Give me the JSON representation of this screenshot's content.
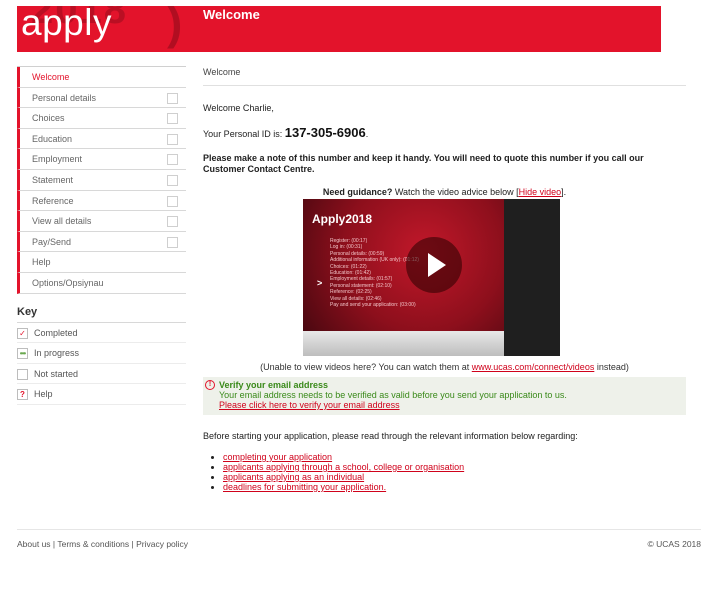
{
  "header": {
    "logo_text": "apply",
    "logo_year": "2018",
    "title": "Welcome",
    "accent_color": "#e3132b"
  },
  "sidebar": {
    "items": [
      {
        "label": "Welcome",
        "active": true,
        "has_checkbox": false
      },
      {
        "label": "Personal details",
        "has_checkbox": true
      },
      {
        "label": "Choices",
        "has_checkbox": true
      },
      {
        "label": "Education",
        "has_checkbox": true
      },
      {
        "label": "Employment",
        "has_checkbox": true
      },
      {
        "label": "Statement",
        "has_checkbox": true
      },
      {
        "label": "Reference",
        "has_checkbox": true
      },
      {
        "label": "View all details",
        "has_checkbox": true
      },
      {
        "label": "Pay/Send",
        "has_checkbox": true
      },
      {
        "label": "Help",
        "has_checkbox": false
      },
      {
        "label": "Options/Opsiynau",
        "has_checkbox": false
      }
    ]
  },
  "key": {
    "title": "Key",
    "items": [
      {
        "label": "Completed",
        "icon": "check-icon",
        "glyph": "✓"
      },
      {
        "label": "In progress",
        "icon": "dots-icon",
        "glyph": "•••"
      },
      {
        "label": "Not started",
        "icon": "empty-box-icon",
        "glyph": ""
      },
      {
        "label": "Help",
        "icon": "question-icon",
        "glyph": "?"
      }
    ]
  },
  "main": {
    "breadcrumb": "Welcome",
    "greeting": "Welcome Charlie,",
    "personal_id_label": "Your Personal ID is:",
    "personal_id": "137-305-6906",
    "personal_id_suffix": ".",
    "note": "Please make a note of this number and keep it handy. You will need to quote this number if you call our Customer Contact Centre.",
    "guidance_bold": "Need guidance?",
    "guidance_text": " Watch the video advice below [",
    "hide_video": "Hide video",
    "guidance_end": "].",
    "video": {
      "title": "Apply2018",
      "chapters": "Register: (00:17)\nLog in: (00:31)\nPersonal details: (00:59)\nAdditional information (UK only): (01:12)\nChoices: (01:22)\nEducation: (01:42)\nEmployment details: (01:57)\nPersonal statement: (02:10)\nReference: (02:25)\nView all details: (02:46)\nPay and send your application: (03:00)"
    },
    "unable_text": "(Unable to view videos here? You can watch them at ",
    "unable_link": "www.ucas.com/connect/videos",
    "unable_end": " instead)",
    "verify": {
      "title": "Verify your email address",
      "desc": "Your email address needs to be verified as valid before you send your application to us.",
      "link": "Please click here to verify your email address"
    },
    "before_text": "Before starting your application, please read through the relevant information below regarding:",
    "links": [
      "completing your application",
      "applicants applying through a school, college or organisation",
      "applicants applying as an individual",
      "deadlines for submitting your application."
    ]
  },
  "footer": {
    "about": "About us",
    "sep1": " | ",
    "terms": "Terms & conditions",
    "sep2": " | ",
    "privacy": "Privacy policy",
    "copyright": "© UCAS 2018"
  }
}
